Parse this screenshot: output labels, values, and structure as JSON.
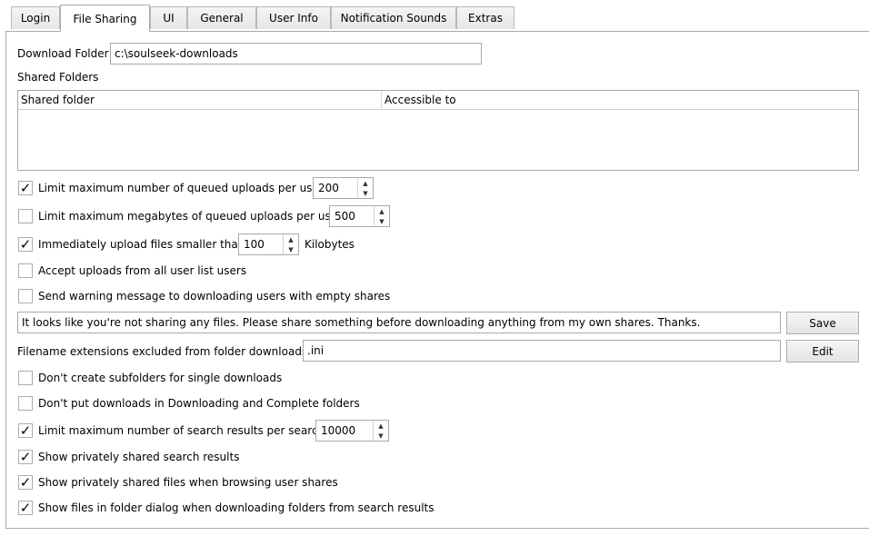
{
  "tabs": [
    {
      "label": "Login"
    },
    {
      "label": "File Sharing"
    },
    {
      "label": "UI"
    },
    {
      "label": "General"
    },
    {
      "label": "User Info"
    },
    {
      "label": "Notification Sounds"
    },
    {
      "label": "Extras"
    }
  ],
  "active_tab": "File Sharing",
  "download_folder": {
    "label": "Download Folder",
    "value": "c:\\soulseek-downloads"
  },
  "shared_folders": {
    "label": "Shared Folders",
    "columns": [
      "Shared folder",
      "Accessible to"
    ],
    "rows": []
  },
  "options": {
    "limit_queued_uploads": {
      "label": "Limit maximum number of queued uploads per user",
      "checked": true,
      "value": "200"
    },
    "limit_queued_megabytes": {
      "label": "Limit maximum megabytes of queued uploads per user",
      "checked": false,
      "value": "500"
    },
    "immediate_upload": {
      "label": "Immediately upload files smaller than",
      "checked": true,
      "value": "100",
      "unit": "Kilobytes"
    },
    "accept_uploads": {
      "label": "Accept uploads from all user list users",
      "checked": false
    },
    "send_warning": {
      "label": "Send warning message to downloading users with empty shares",
      "checked": false
    }
  },
  "warning_message": {
    "value": "It looks like you're not sharing any files. Please share something before downloading anything from my own shares. Thanks.",
    "save_label": "Save"
  },
  "excluded_extensions": {
    "label": "Filename extensions excluded from folder downloads:",
    "value": ".ini",
    "edit_label": "Edit"
  },
  "options2": {
    "no_subfolders": {
      "label": "Don't create subfolders for single downloads",
      "checked": false
    },
    "no_downloading_folders": {
      "label": "Don't put downloads in Downloading and Complete folders",
      "checked": false
    },
    "limit_search_results": {
      "label": "Limit maximum number of search results per search",
      "checked": true,
      "value": "10000"
    },
    "show_private_search": {
      "label": "Show privately shared search results",
      "checked": true
    },
    "show_private_browse": {
      "label": "Show privately shared files when browsing user shares",
      "checked": true
    },
    "show_files_dialog": {
      "label": "Show files in folder dialog when downloading folders from search results",
      "checked": true
    }
  },
  "glyphs": {
    "check": "✓",
    "up": "▲",
    "down": "▼"
  }
}
